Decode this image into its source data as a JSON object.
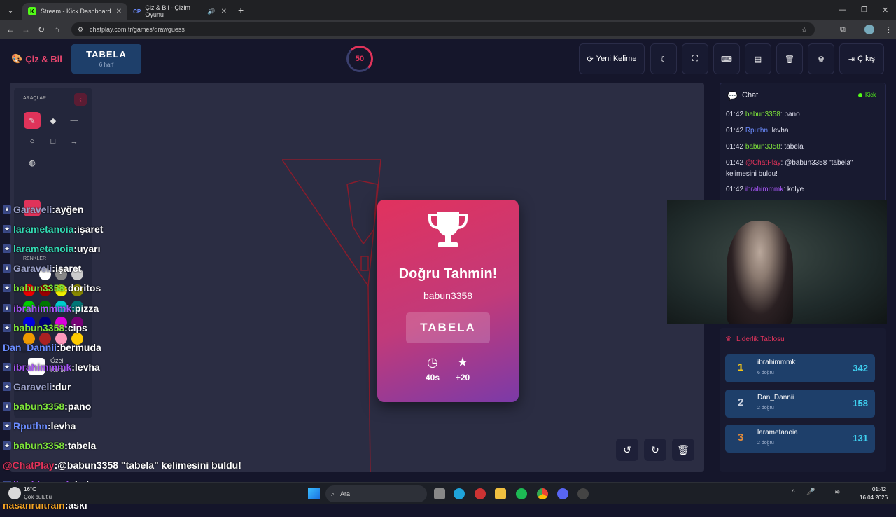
{
  "browser": {
    "tabs": [
      {
        "label": "Stream - Kick Dashboard",
        "favicon": "K",
        "active": true
      },
      {
        "label": "Çiz & Bil - Çizim Oyunu",
        "favicon": "CP",
        "active": false
      }
    ],
    "url": "chatplay.com.tr/games/drawguess"
  },
  "header": {
    "logo": "Çiz & Bil",
    "word": "TABELA",
    "word_hint": "6 harf",
    "timer": "50",
    "new_word_label": "Yeni Kelime",
    "exit_label": "Çıkış"
  },
  "tools": {
    "title": "ARAÇLAR",
    "colors_title": "RENKLER",
    "custom_color_label_1": "Özel",
    "custom_color_label_2": "Renk"
  },
  "overlay_chat": [
    {
      "user": "Garaveli",
      "msg": "ayğen",
      "color": "#9aa0c8"
    },
    {
      "user": "larametanoia",
      "msg": "işaret",
      "color": "#33d9b2"
    },
    {
      "user": "larametanoia",
      "msg": "uyarı",
      "color": "#33d9b2"
    },
    {
      "user": "Garaveli",
      "msg": "işaret",
      "color": "#9aa0c8"
    },
    {
      "user": "babun3358",
      "msg": "doritos",
      "color": "#7ee43a"
    },
    {
      "user": "ibrahimmmk",
      "msg": "pizza",
      "color": "#a855f7"
    },
    {
      "user": "babun3358",
      "msg": "cips",
      "color": "#7ee43a"
    },
    {
      "user": "Dan_Dannii",
      "msg": "bermuda",
      "color": "#6b8cff"
    },
    {
      "user": "ibrahimmmk",
      "msg": "levha",
      "color": "#a855f7"
    },
    {
      "user": "Garaveli",
      "msg": "dur",
      "color": "#9aa0c8"
    },
    {
      "user": "babun3358",
      "msg": "pano",
      "color": "#7ee43a"
    },
    {
      "user": "Rputhn",
      "msg": "levha",
      "color": "#6b8cff"
    },
    {
      "user": "babun3358",
      "msg": "tabela",
      "color": "#7ee43a"
    },
    {
      "user": "@ChatPlay",
      "msg": "@babun3358 \"tabela\" kelimesini buldu!",
      "color": "#e0335a"
    },
    {
      "user": "ibrahimmmk",
      "msg": "kolye",
      "color": "#a855f7"
    },
    {
      "user": "hasanrultrain",
      "msg": "askı",
      "color": "#f5a623"
    }
  ],
  "modal": {
    "title": "Doğru Tahmin!",
    "winner": "babun3358",
    "word": "TABELA",
    "time": "40s",
    "points": "+20"
  },
  "chat_panel": {
    "title": "Chat",
    "platform": "Kick",
    "messages": [
      {
        "time": "01:42",
        "user": "babun3358",
        "msg": ": pano",
        "color": "#7ee43a"
      },
      {
        "time": "01:42",
        "user": "Rputhn",
        "msg": ": levha",
        "color": "#6b8cff"
      },
      {
        "time": "01:42",
        "user": "babun3358",
        "msg": ": tabela",
        "color": "#7ee43a"
      },
      {
        "time": "01:42",
        "user": "@ChatPlay",
        "msg": ": @babun3358 \"tabela\" kelimesini buldu!",
        "color": "#e0335a"
      },
      {
        "time": "01:42",
        "user": "ibrahimmmk",
        "msg": ": kolye",
        "color": "#a855f7"
      }
    ]
  },
  "leaderboard": {
    "title": "Liderlik Tablosu",
    "rows": [
      {
        "rank": "1",
        "name": "ibrahimmmk",
        "sub": "6 doğru",
        "points": "342",
        "rank_color": "#f5c518"
      },
      {
        "rank": "2",
        "name": "Dan_Dannii",
        "sub": "2 doğru",
        "points": "158",
        "rank_color": "#c9d1e0"
      },
      {
        "rank": "3",
        "name": "larametanoia",
        "sub": "2 doğru",
        "points": "131",
        "rank_color": "#e08a3a"
      }
    ]
  },
  "taskbar": {
    "weather_temp": "16°C",
    "weather_desc": "Çok bulutlu",
    "search_label": "Ara",
    "time": "01:42",
    "date": "16.04.2026"
  }
}
